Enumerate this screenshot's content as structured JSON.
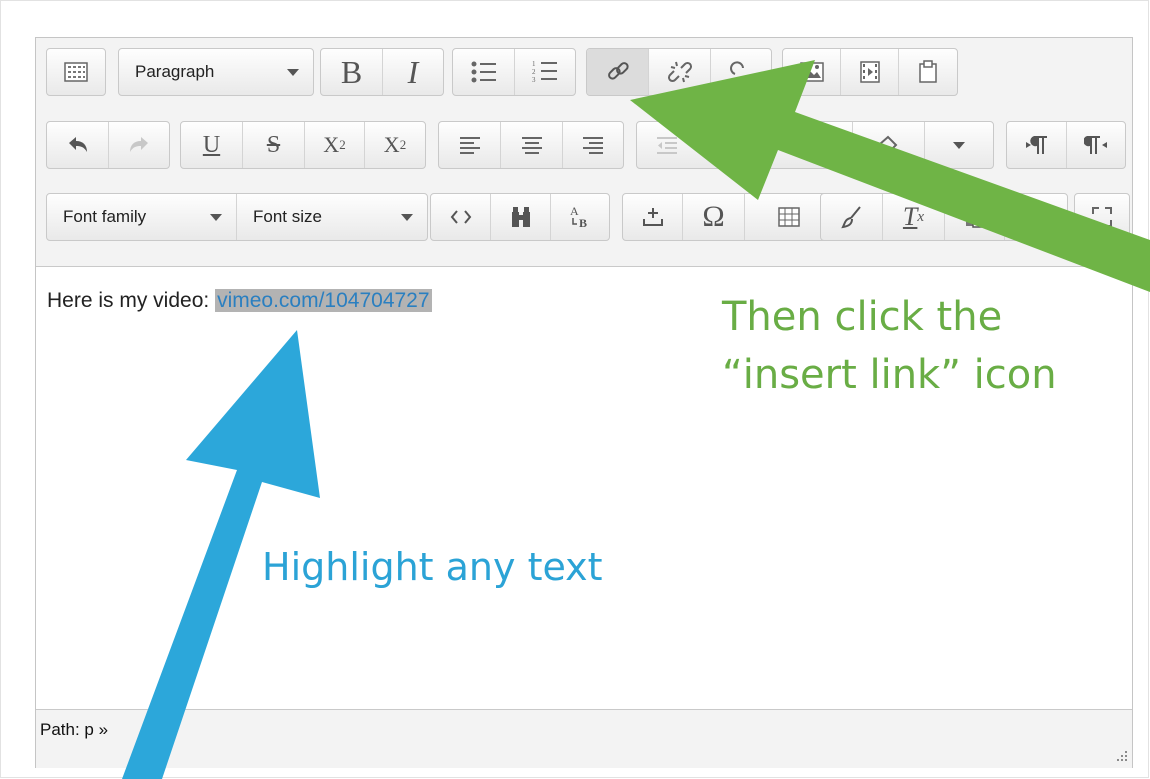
{
  "toolbar": {
    "paragraph_select": "Paragraph",
    "font_family_select": "Font family",
    "font_size_select": "Font size",
    "bold_label": "B",
    "italic_label": "I",
    "underline_label": "U",
    "strike_label": "S",
    "subscript_label": "X",
    "subscript_sub": "2",
    "superscript_label": "X",
    "superscript_sup": "2",
    "omega_label": "Ω",
    "clear_format_label": "T",
    "clear_format_sub": "x"
  },
  "content": {
    "prefix": "Here is my video: ",
    "selected_text": "vimeo.com/104704727"
  },
  "status": {
    "path": "Path: p »"
  },
  "annotations": {
    "green_line1": "Then click the",
    "green_line2": "“insert link” icon",
    "blue_text": "Highlight any text",
    "green_color": "#69ad45",
    "blue_color": "#2ba3d6"
  }
}
